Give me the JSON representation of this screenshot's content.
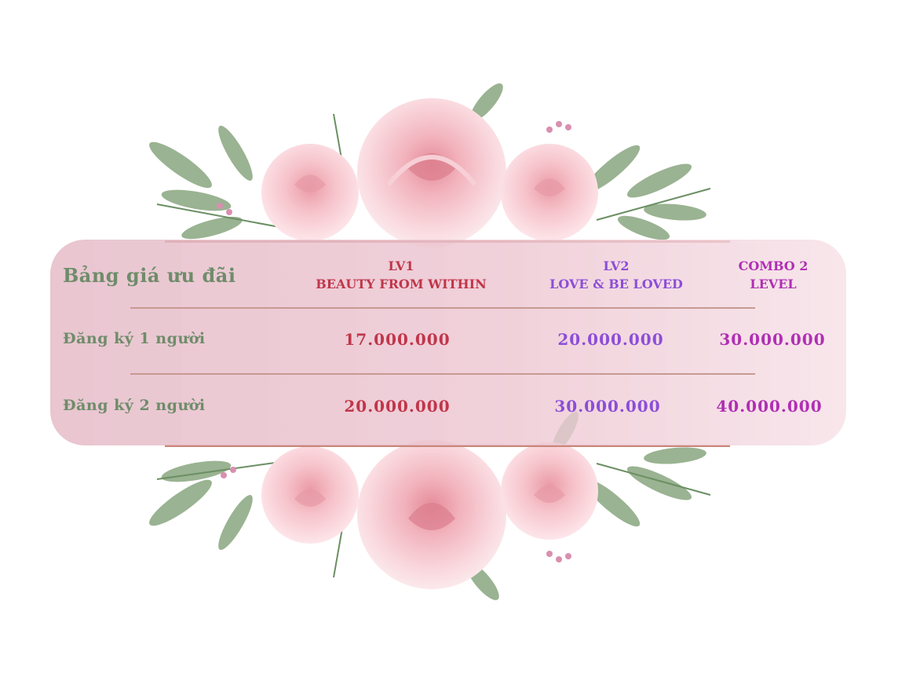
{
  "title": "Bảng giá ưu đãi",
  "columns": [
    {
      "line1": "LV1",
      "line2": "BEAUTY FROM WITHIN",
      "color": "#c0364a"
    },
    {
      "line1": "LV2",
      "line2": "LOVE & BE LOVED",
      "color": "#8b4ed8"
    },
    {
      "line1": "COMBO 2",
      "line2": "LEVEL",
      "color": "#b02fb4"
    }
  ],
  "rows": [
    {
      "label": "Đăng ký 1 người",
      "prices": [
        "17.000.000",
        "20.000.000",
        "30.000.000"
      ]
    },
    {
      "label": "Đăng ký 2 người",
      "prices": [
        "20.000.000",
        "30.000.000",
        "40.000.000"
      ]
    }
  ],
  "decoration": {
    "roses": "pink-rose-icon",
    "leaves": "green-leaf-icon"
  }
}
